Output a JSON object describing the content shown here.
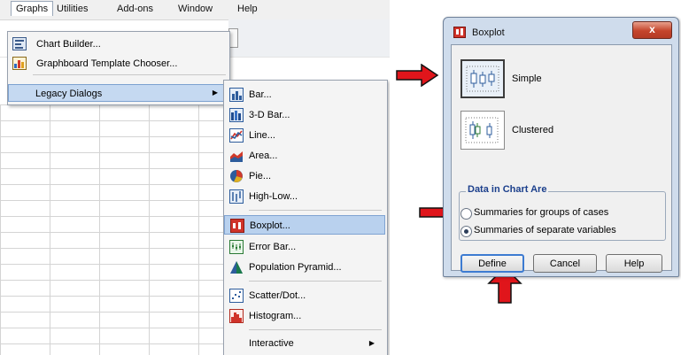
{
  "spss": {
    "menubar": [
      "Graphs",
      "Utilities",
      "Add-ons",
      "Window",
      "Help"
    ],
    "graphs_menu": {
      "items": [
        {
          "label": "Chart Builder...",
          "icon": "chart-builder-icon"
        },
        {
          "label": "Graphboard Template Chooser...",
          "icon": "graphboard-icon"
        },
        {
          "label": "Legacy Dialogs",
          "icon": ""
        }
      ]
    },
    "legacy_menu": {
      "items": [
        {
          "label": "Bar...",
          "icon": "bar-chart-icon"
        },
        {
          "label": "3-D Bar...",
          "icon": "3d-bar-icon"
        },
        {
          "label": "Line...",
          "icon": "line-chart-icon"
        },
        {
          "label": "Area...",
          "icon": "area-chart-icon"
        },
        {
          "label": "Pie...",
          "icon": "pie-chart-icon"
        },
        {
          "label": "High-Low...",
          "icon": "high-low-icon"
        },
        {
          "label": "Boxplot...",
          "icon": "boxplot-icon"
        },
        {
          "label": "Error Bar...",
          "icon": "error-bar-icon"
        },
        {
          "label": "Population Pyramid...",
          "icon": "pyramid-icon"
        },
        {
          "label": "Scatter/Dot...",
          "icon": "scatter-icon"
        },
        {
          "label": "Histogram...",
          "icon": "histogram-icon"
        },
        {
          "label": "Interactive",
          "icon": ""
        }
      ]
    }
  },
  "dialog": {
    "title": "Boxplot",
    "close_glyph": "x",
    "chart_types": [
      {
        "label": "Simple",
        "selected": true
      },
      {
        "label": "Clustered",
        "selected": false
      }
    ],
    "group_title": "Data in Chart Are",
    "options": [
      {
        "label": "Summaries for groups of cases",
        "checked": false
      },
      {
        "label": "Summaries of separate variables",
        "checked": true
      }
    ],
    "buttons": [
      "Define",
      "Cancel",
      "Help"
    ]
  },
  "colors": {
    "arrow": "#e0151b",
    "highlight": "#b9d1ee",
    "dialog_frame": "#cfdcec",
    "close_button": "#c4442b",
    "group_title": "#1b3f8c"
  }
}
